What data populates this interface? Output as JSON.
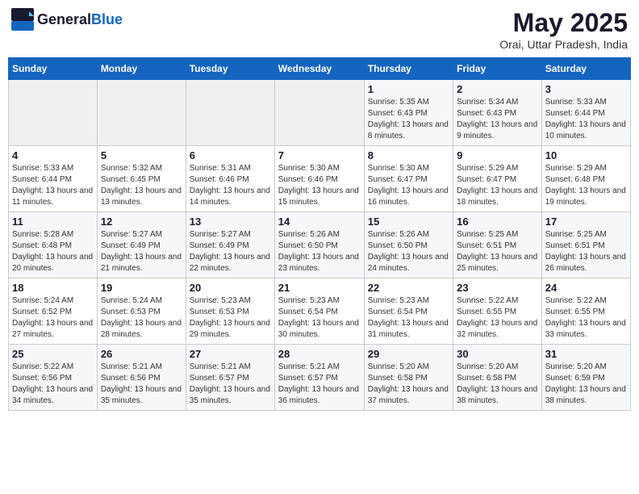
{
  "header": {
    "logo_general": "General",
    "logo_blue": "Blue",
    "title": "May 2025",
    "subtitle": "Orai, Uttar Pradesh, India"
  },
  "weekdays": [
    "Sunday",
    "Monday",
    "Tuesday",
    "Wednesday",
    "Thursday",
    "Friday",
    "Saturday"
  ],
  "weeks": [
    [
      {
        "day": "",
        "detail": ""
      },
      {
        "day": "",
        "detail": ""
      },
      {
        "day": "",
        "detail": ""
      },
      {
        "day": "",
        "detail": ""
      },
      {
        "day": "1",
        "detail": "Sunrise: 5:35 AM\nSunset: 6:43 PM\nDaylight: 13 hours and 8 minutes."
      },
      {
        "day": "2",
        "detail": "Sunrise: 5:34 AM\nSunset: 6:43 PM\nDaylight: 13 hours and 9 minutes."
      },
      {
        "day": "3",
        "detail": "Sunrise: 5:33 AM\nSunset: 6:44 PM\nDaylight: 13 hours and 10 minutes."
      }
    ],
    [
      {
        "day": "4",
        "detail": "Sunrise: 5:33 AM\nSunset: 6:44 PM\nDaylight: 13 hours and 11 minutes."
      },
      {
        "day": "5",
        "detail": "Sunrise: 5:32 AM\nSunset: 6:45 PM\nDaylight: 13 hours and 13 minutes."
      },
      {
        "day": "6",
        "detail": "Sunrise: 5:31 AM\nSunset: 6:46 PM\nDaylight: 13 hours and 14 minutes."
      },
      {
        "day": "7",
        "detail": "Sunrise: 5:30 AM\nSunset: 6:46 PM\nDaylight: 13 hours and 15 minutes."
      },
      {
        "day": "8",
        "detail": "Sunrise: 5:30 AM\nSunset: 6:47 PM\nDaylight: 13 hours and 16 minutes."
      },
      {
        "day": "9",
        "detail": "Sunrise: 5:29 AM\nSunset: 6:47 PM\nDaylight: 13 hours and 18 minutes."
      },
      {
        "day": "10",
        "detail": "Sunrise: 5:29 AM\nSunset: 6:48 PM\nDaylight: 13 hours and 19 minutes."
      }
    ],
    [
      {
        "day": "11",
        "detail": "Sunrise: 5:28 AM\nSunset: 6:48 PM\nDaylight: 13 hours and 20 minutes."
      },
      {
        "day": "12",
        "detail": "Sunrise: 5:27 AM\nSunset: 6:49 PM\nDaylight: 13 hours and 21 minutes."
      },
      {
        "day": "13",
        "detail": "Sunrise: 5:27 AM\nSunset: 6:49 PM\nDaylight: 13 hours and 22 minutes."
      },
      {
        "day": "14",
        "detail": "Sunrise: 5:26 AM\nSunset: 6:50 PM\nDaylight: 13 hours and 23 minutes."
      },
      {
        "day": "15",
        "detail": "Sunrise: 5:26 AM\nSunset: 6:50 PM\nDaylight: 13 hours and 24 minutes."
      },
      {
        "day": "16",
        "detail": "Sunrise: 5:25 AM\nSunset: 6:51 PM\nDaylight: 13 hours and 25 minutes."
      },
      {
        "day": "17",
        "detail": "Sunrise: 5:25 AM\nSunset: 6:51 PM\nDaylight: 13 hours and 26 minutes."
      }
    ],
    [
      {
        "day": "18",
        "detail": "Sunrise: 5:24 AM\nSunset: 6:52 PM\nDaylight: 13 hours and 27 minutes."
      },
      {
        "day": "19",
        "detail": "Sunrise: 5:24 AM\nSunset: 6:53 PM\nDaylight: 13 hours and 28 minutes."
      },
      {
        "day": "20",
        "detail": "Sunrise: 5:23 AM\nSunset: 6:53 PM\nDaylight: 13 hours and 29 minutes."
      },
      {
        "day": "21",
        "detail": "Sunrise: 5:23 AM\nSunset: 6:54 PM\nDaylight: 13 hours and 30 minutes."
      },
      {
        "day": "22",
        "detail": "Sunrise: 5:23 AM\nSunset: 6:54 PM\nDaylight: 13 hours and 31 minutes."
      },
      {
        "day": "23",
        "detail": "Sunrise: 5:22 AM\nSunset: 6:55 PM\nDaylight: 13 hours and 32 minutes."
      },
      {
        "day": "24",
        "detail": "Sunrise: 5:22 AM\nSunset: 6:55 PM\nDaylight: 13 hours and 33 minutes."
      }
    ],
    [
      {
        "day": "25",
        "detail": "Sunrise: 5:22 AM\nSunset: 6:56 PM\nDaylight: 13 hours and 34 minutes."
      },
      {
        "day": "26",
        "detail": "Sunrise: 5:21 AM\nSunset: 6:56 PM\nDaylight: 13 hours and 35 minutes."
      },
      {
        "day": "27",
        "detail": "Sunrise: 5:21 AM\nSunset: 6:57 PM\nDaylight: 13 hours and 35 minutes."
      },
      {
        "day": "28",
        "detail": "Sunrise: 5:21 AM\nSunset: 6:57 PM\nDaylight: 13 hours and 36 minutes."
      },
      {
        "day": "29",
        "detail": "Sunrise: 5:20 AM\nSunset: 6:58 PM\nDaylight: 13 hours and 37 minutes."
      },
      {
        "day": "30",
        "detail": "Sunrise: 5:20 AM\nSunset: 6:58 PM\nDaylight: 13 hours and 38 minutes."
      },
      {
        "day": "31",
        "detail": "Sunrise: 5:20 AM\nSunset: 6:59 PM\nDaylight: 13 hours and 38 minutes."
      }
    ]
  ]
}
